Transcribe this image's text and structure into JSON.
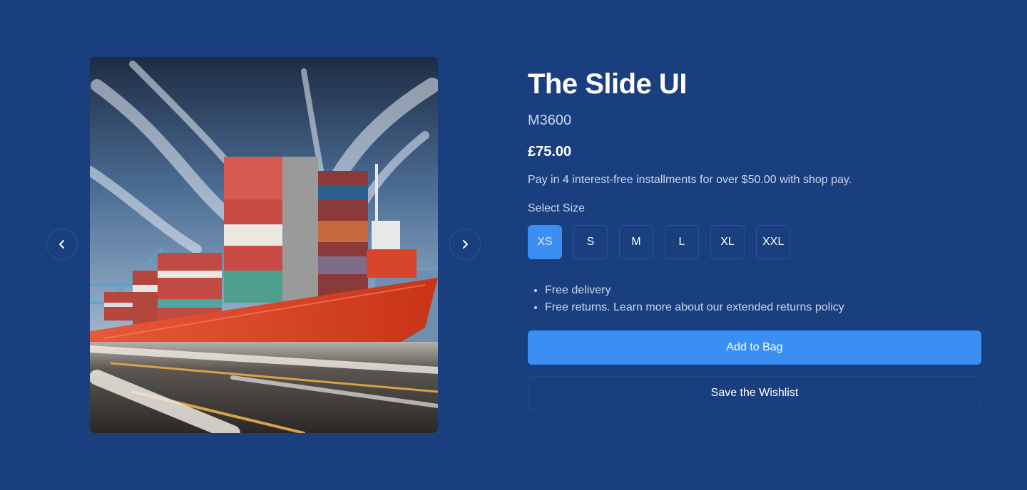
{
  "colors": {
    "background": "#1a3f7f",
    "accent": "#3b8ff3",
    "muted_text": "#c9d6ee",
    "border": "#2a5297"
  },
  "gallery": {
    "image_alt": "Red container ship loaded with stacked shipping containers sailing past a blurred road under a streaked blue sky",
    "prev_icon": "chevron-left-icon",
    "next_icon": "chevron-right-icon"
  },
  "product": {
    "title": "The Slide UI",
    "sku": "M3600",
    "price": "£75.00",
    "installments": "Pay in 4 interest-free installments for over $50.00 with shop pay.",
    "size_label": "Select Size",
    "sizes": [
      "XS",
      "S",
      "M",
      "L",
      "XL",
      "XXL"
    ],
    "selected_size": "XS",
    "features": [
      "Free delivery",
      "Free returns. Learn more about our extended returns policy"
    ],
    "add_to_bag_label": "Add to Bag",
    "wishlist_label": "Save the Wishlist"
  }
}
